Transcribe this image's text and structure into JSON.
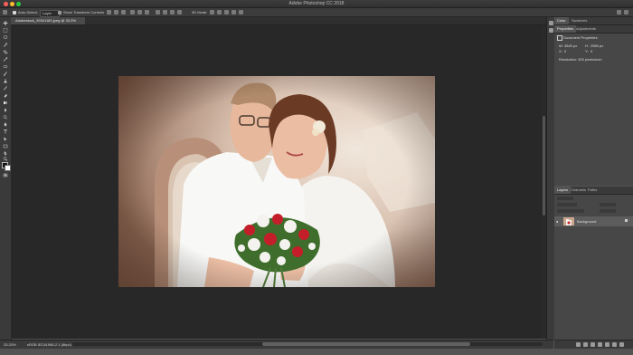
{
  "app": {
    "title": "Adobe Photoshop CC 2018"
  },
  "options_bar": {
    "auto_select_label": "Auto-Select:",
    "auto_select_value": "Layer",
    "transform_label": "Show Transform Controls",
    "mode_label": "3D Mode:"
  },
  "document": {
    "tab_label": "Adobestock_39341183.jpeg @ 33.3% (RGB/8) *",
    "zoom": "33.33%",
    "profile": "sRGB IEC61966-2.1 (8bpc)"
  },
  "properties_panel": {
    "tabs": [
      "Color",
      "Swatches"
    ],
    "sub_tabs": [
      "Properties",
      "Adjustments"
    ],
    "heading": "Document Properties",
    "width_label": "W:",
    "width_value": "3840 px",
    "height_label": "H:",
    "height_value": "2560 px",
    "x_label": "X:",
    "x_value": "0",
    "y_label": "Y:",
    "y_value": "0",
    "resolution": "Resolution: 300 pixels/inch"
  },
  "layers_panel": {
    "tabs": [
      "Layers",
      "Channels",
      "Paths"
    ],
    "layer_name": "Background"
  },
  "colors": {
    "canvas_bg": "#282828",
    "panel_bg": "#535353",
    "chrome": "#3a3a3a"
  }
}
